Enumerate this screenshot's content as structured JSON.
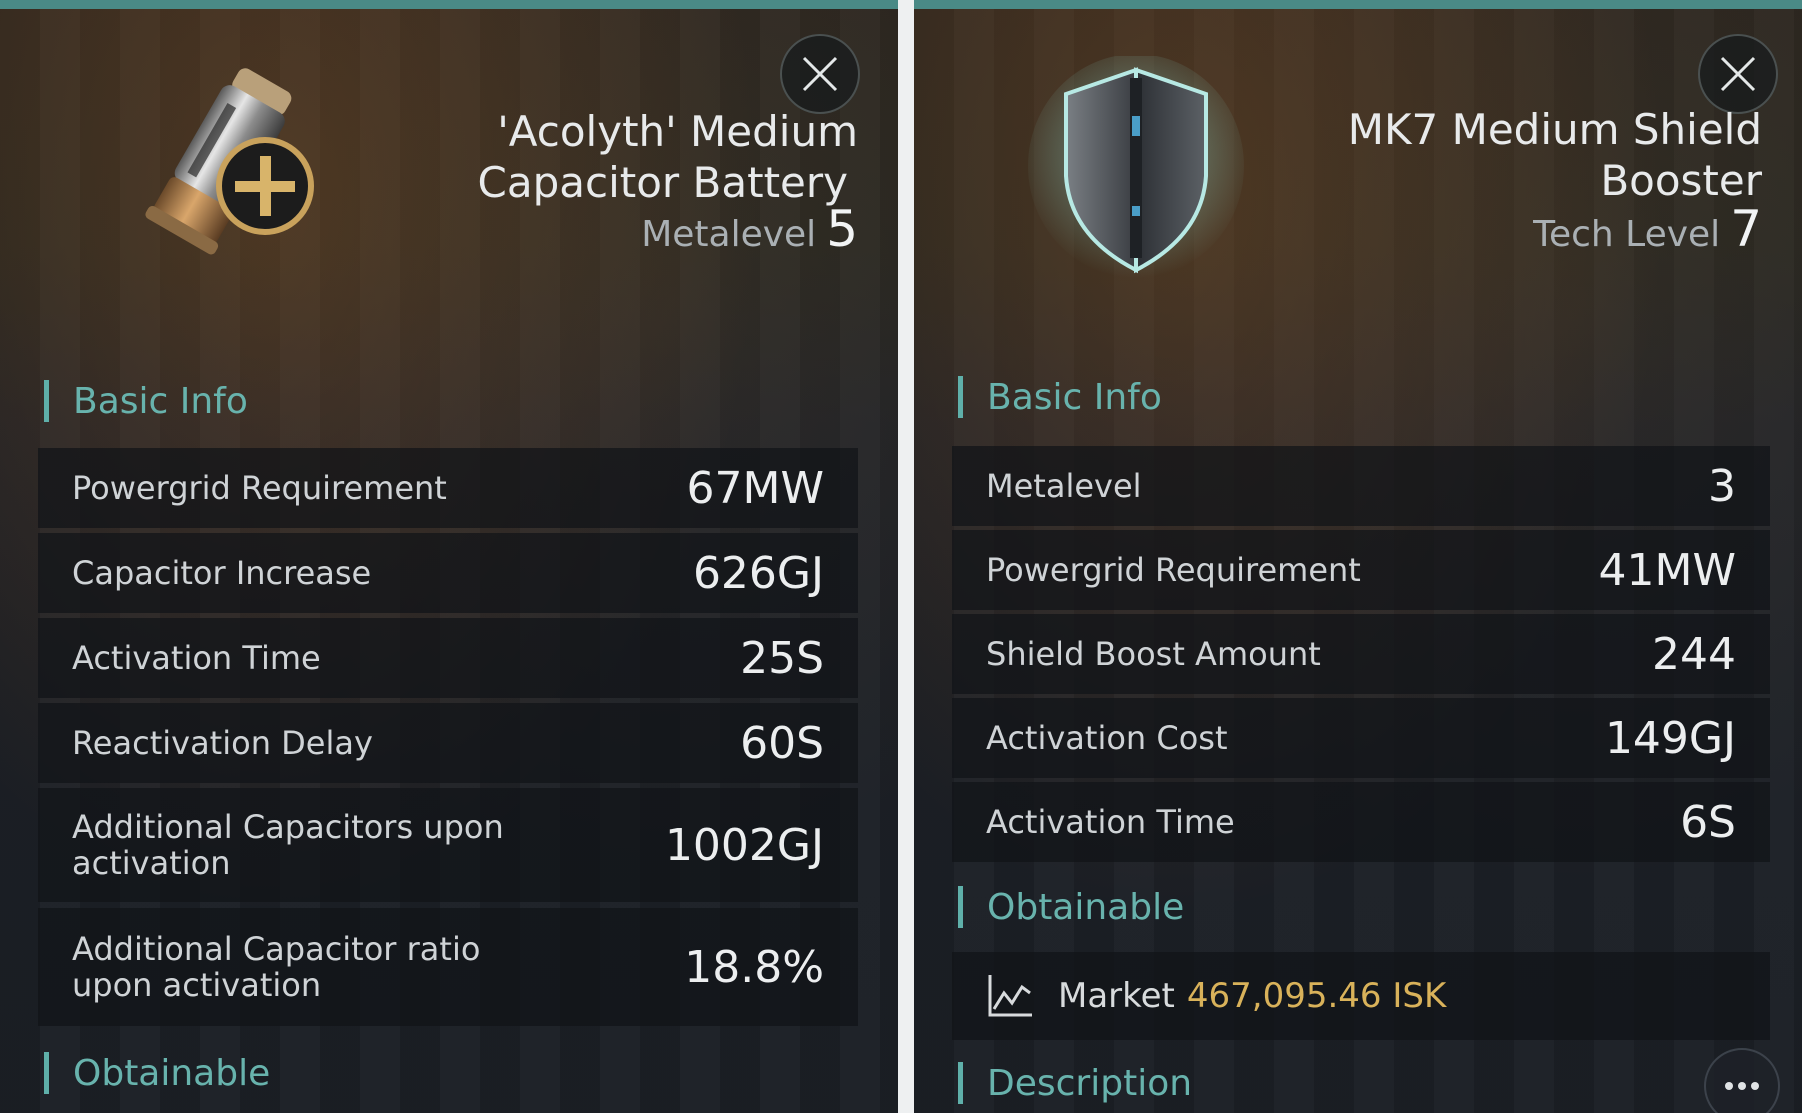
{
  "colors": {
    "accent": "#5fb0aa",
    "price": "#d9b25a",
    "row_bg": "#14171b"
  },
  "left_panel": {
    "close_icon": "close-icon",
    "item_icon": "capacitor-battery-icon",
    "title_line1": "'Acolyth' Medium",
    "title_line2": "Capacitor Battery",
    "level_label": "Metalevel",
    "level_value": "5",
    "basic_info_label": "Basic Info",
    "stats": [
      {
        "label": "Powergrid Requirement",
        "value": "67MW"
      },
      {
        "label": "Capacitor Increase",
        "value": "626GJ"
      },
      {
        "label": "Activation Time",
        "value": "25S"
      },
      {
        "label": "Reactivation Delay",
        "value": "60S"
      },
      {
        "label": "Additional Capacitors upon activation",
        "value": "1002GJ"
      },
      {
        "label": "Additional Capacitor ratio upon activation",
        "value": "18.8%"
      }
    ],
    "obtainable_label": "Obtainable"
  },
  "right_panel": {
    "close_icon": "close-icon",
    "item_icon": "shield-booster-icon",
    "title_line1": "MK7 Medium Shield",
    "title_line2": "Booster",
    "level_label": "Tech Level",
    "level_value": "7",
    "basic_info_label": "Basic Info",
    "stats": [
      {
        "label": "Metalevel",
        "value": "3"
      },
      {
        "label": "Powergrid Requirement",
        "value": "41MW"
      },
      {
        "label": "Shield Boost Amount",
        "value": "244"
      },
      {
        "label": "Activation Cost",
        "value": "149GJ"
      },
      {
        "label": "Activation Time",
        "value": "6S"
      }
    ],
    "obtainable_label": "Obtainable",
    "market_label": "Market",
    "market_price": "467,095.46 ISK",
    "description_label": "Description",
    "more_icon": "more-icon"
  }
}
